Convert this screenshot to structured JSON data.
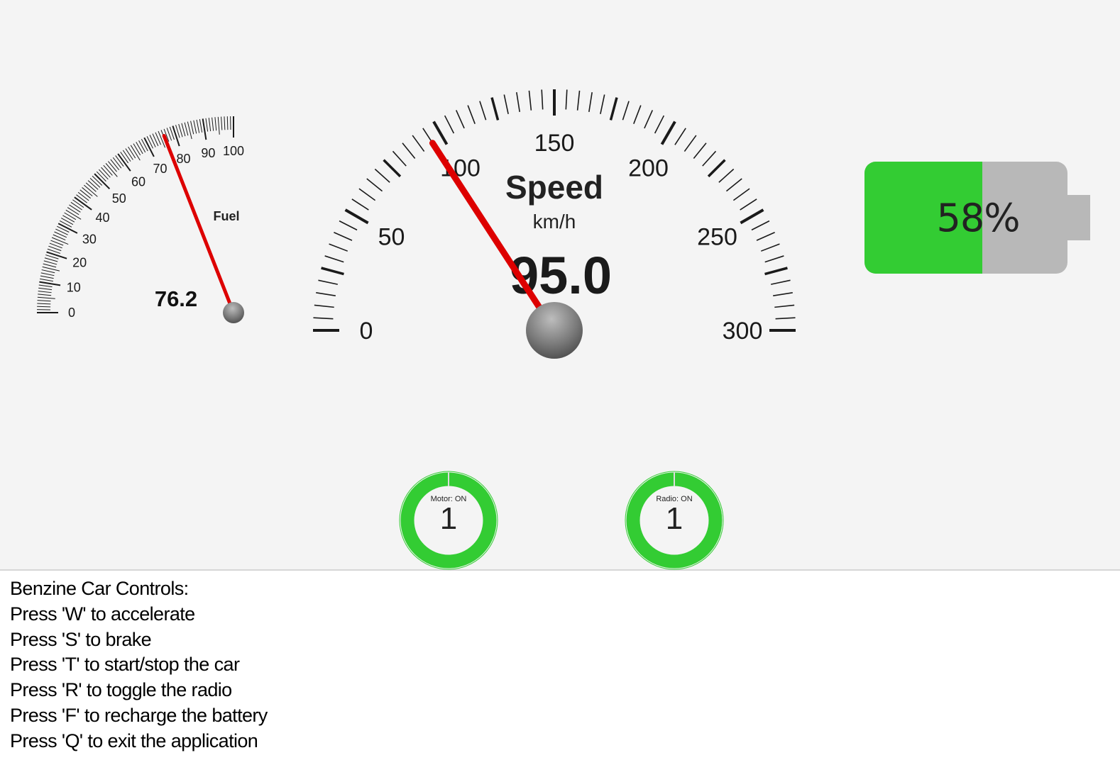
{
  "fuel_gauge": {
    "label": "Fuel",
    "value": 76.2,
    "value_text": "76.2",
    "min": 0,
    "max": 100,
    "tick_labels": [
      "0",
      "10",
      "20",
      "30",
      "40",
      "50",
      "60",
      "70",
      "80",
      "90",
      "100"
    ]
  },
  "speed_gauge": {
    "title": "Speed",
    "unit": "km/h",
    "value": 95.0,
    "value_text": "95.0",
    "min": 0,
    "max": 300,
    "tick_labels": [
      "0",
      "50",
      "100",
      "150",
      "200",
      "250",
      "300"
    ]
  },
  "battery": {
    "level": 0.58,
    "label": "58%"
  },
  "indicators": [
    {
      "caption": "Motor: ON",
      "value": "1"
    },
    {
      "caption": "Radio: ON",
      "value": "1"
    }
  ],
  "controls": {
    "title": "Benzine Car Controls:",
    "lines": [
      "Press 'W' to accelerate",
      "Press 'S' to brake",
      "Press 'T' to start/stop the car",
      "Press 'R' to toggle the radio",
      "Press 'F' to recharge the battery",
      "Press 'Q' to exit the application"
    ]
  },
  "colors": {
    "needle": "#dd0000",
    "battery_fill": "#33cc33",
    "battery_empty": "#b8b8b8",
    "ring": "#33cc33",
    "panel_bg": "#f4f4f4"
  }
}
